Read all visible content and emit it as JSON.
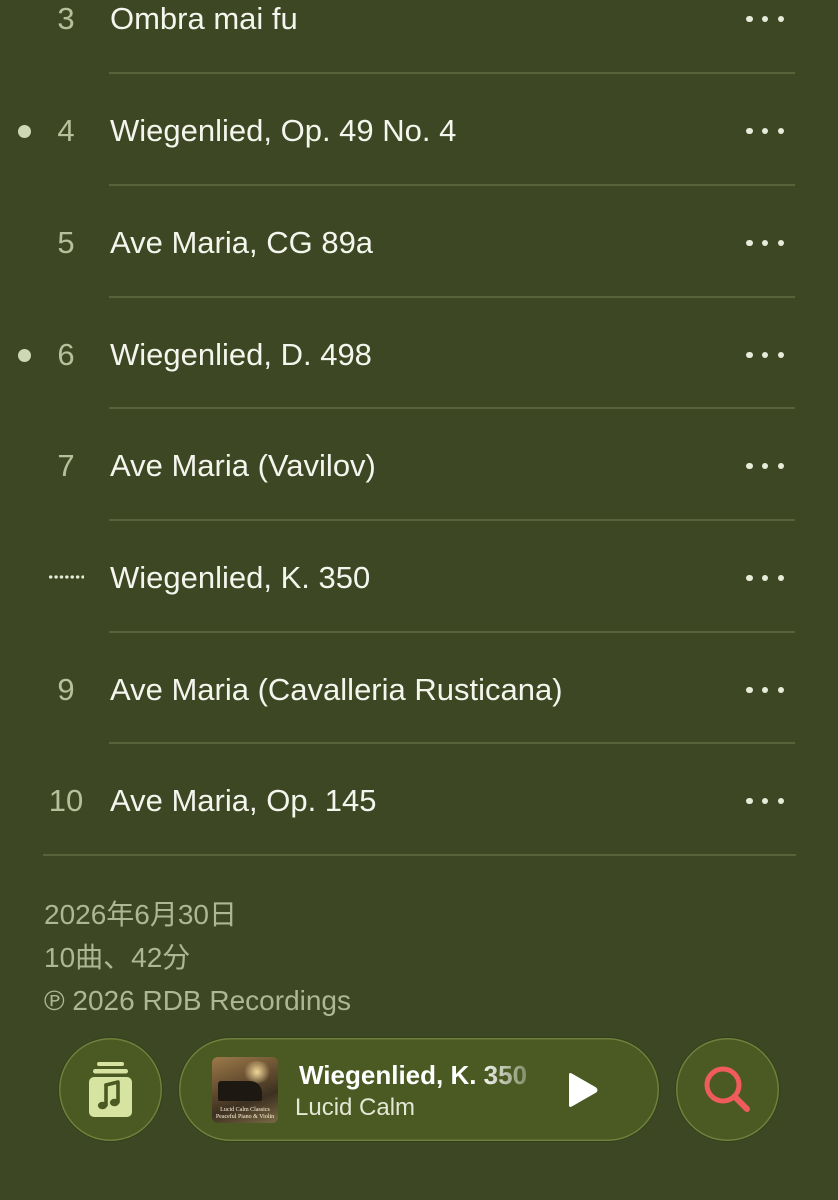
{
  "tracks": [
    {
      "number": "3",
      "title": "Ombra mai fu",
      "state": "normal"
    },
    {
      "number": "4",
      "title": "Wiegenlied, Op. 49 No. 4",
      "state": "dot"
    },
    {
      "number": "5",
      "title": "Ave Maria, CG 89a",
      "state": "normal"
    },
    {
      "number": "6",
      "title": "Wiegenlied, D. 498",
      "state": "dot"
    },
    {
      "number": "7",
      "title": "Ave Maria (Vavilov)",
      "state": "normal"
    },
    {
      "number": "",
      "title": "Wiegenlied, K. 350",
      "state": "playing"
    },
    {
      "number": "9",
      "title": "Ave Maria (Cavalleria Rusticana)",
      "state": "normal"
    },
    {
      "number": "10",
      "title": "Ave Maria, Op. 145",
      "state": "normal"
    }
  ],
  "album_info": {
    "release_date": "2026年6月30日",
    "track_summary": "10曲、42分",
    "copyright": "℗ 2026 RDB Recordings"
  },
  "mini_player": {
    "title": "Wiegenlied, K. 350",
    "artist": "Lucid Calm",
    "artwork_caption_line1": "Lucid Calm Classics",
    "artwork_caption_line2": "Peaceful Piano & Violin"
  },
  "icons": {
    "library": "music-library-icon",
    "play": "play-icon",
    "search": "search-icon",
    "more": "more-ellipsis-icon"
  },
  "colors": {
    "background": "#3d4724",
    "button_fill": "#4a5a22",
    "search_accent": "#f05b5b",
    "text_primary": "#f4f5ec",
    "text_secondary": "#aeb794"
  }
}
